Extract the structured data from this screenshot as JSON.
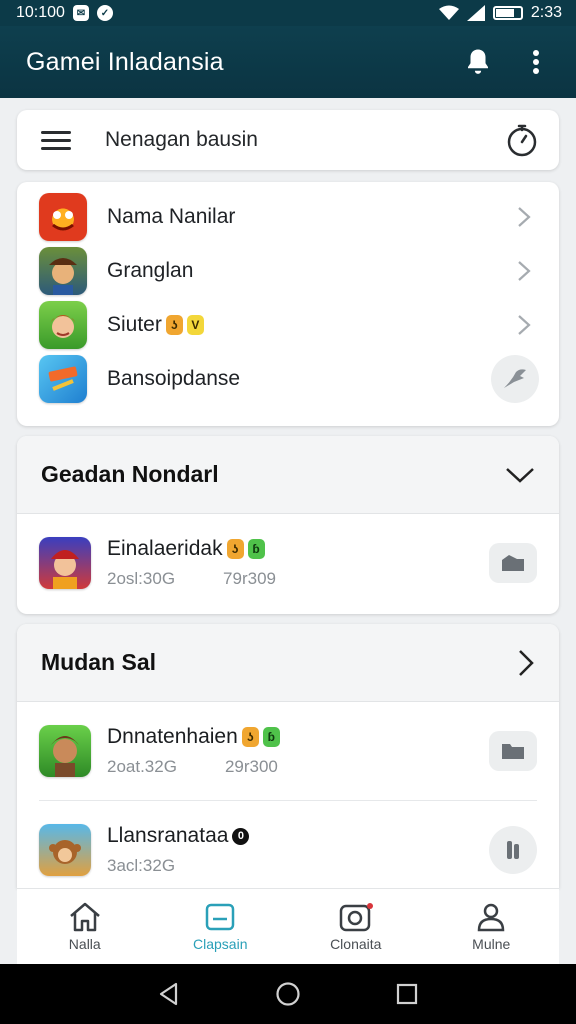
{
  "status_bar": {
    "time_left": "10:100",
    "time_right": "2:33"
  },
  "app_bar": {
    "title": "Gamei Inladansia"
  },
  "search": {
    "text": "Nenagan bausin"
  },
  "app_list": [
    {
      "label": "Nama Nanilar",
      "icon": "red-monster-app-icon",
      "action": "chevron"
    },
    {
      "label": "Granglan",
      "icon": "pirate-app-icon",
      "action": "chevron"
    },
    {
      "label": "Siuter",
      "icon": "girl-app-icon",
      "action": "chevron",
      "badges": [
        "ʖ",
        "V"
      ]
    },
    {
      "label": "Bansoipdanse",
      "icon": "blue-app-icon",
      "action": "round-button"
    }
  ],
  "section1": {
    "title": "Geadan Nondarl",
    "items": [
      {
        "title": "Einalaeridak",
        "meta1": "2osl:30G",
        "meta2": "79r309",
        "badges": [
          "ʖ",
          "ɓ"
        ]
      }
    ]
  },
  "section2": {
    "title": "Mudan Sal",
    "items": [
      {
        "title": "Dnnatenhaien",
        "meta1": "2oat.32G",
        "meta2": "29r300",
        "badges": [
          "ʖ",
          "ɓ"
        ]
      },
      {
        "title": "Llansranataa",
        "meta1": "3acl:32G",
        "meta2": "",
        "badges": [
          "0"
        ]
      }
    ]
  },
  "bottom_nav": [
    {
      "label": "Nalla",
      "icon": "home-icon"
    },
    {
      "label": "Clapsain",
      "icon": "tablet-icon",
      "active": true
    },
    {
      "label": "Clonaita",
      "icon": "camera-icon"
    },
    {
      "label": "Mulne",
      "icon": "person-icon"
    }
  ],
  "colors": {
    "app_bar": "#0e3f4e",
    "accent": "#2aa0b8"
  }
}
